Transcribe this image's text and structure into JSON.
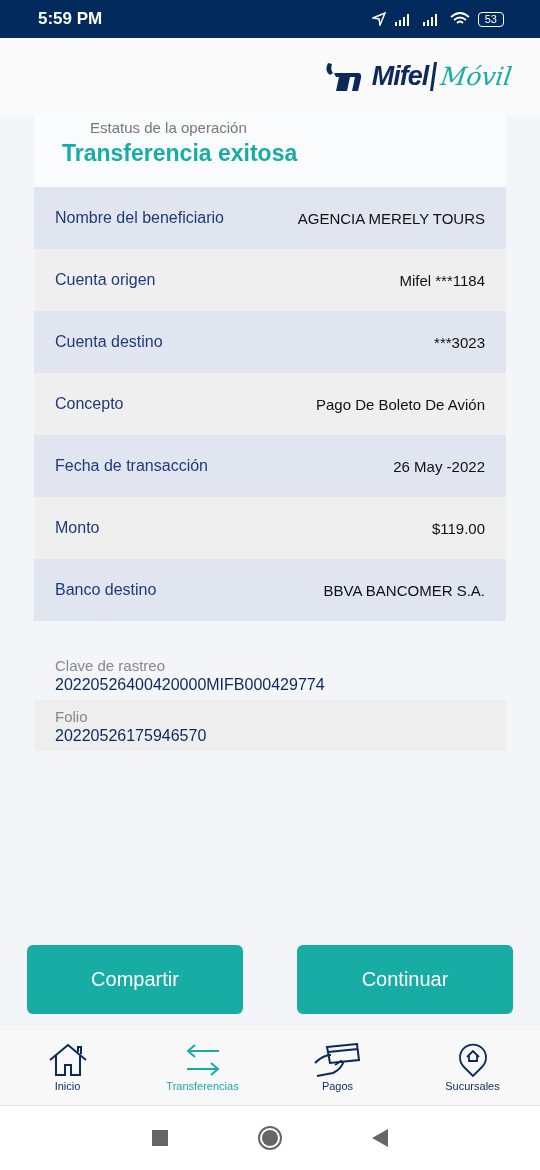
{
  "status_bar": {
    "time": "5:59 PM",
    "battery": "53"
  },
  "header": {
    "logo_brand": "Mifel",
    "logo_product": "Móvil"
  },
  "status": {
    "label": "Estatus de la operación",
    "title": "Transferencia exitosa"
  },
  "details": [
    {
      "label": "Nombre del beneficiario",
      "value": "AGENCIA MERELY TOURS"
    },
    {
      "label": "Cuenta origen",
      "value": "Mifel ***1184"
    },
    {
      "label": "Cuenta destino",
      "value": "***3023"
    },
    {
      "label": "Concepto",
      "value": "Pago De Boleto De Avión"
    },
    {
      "label": "Fecha de transacción",
      "value": "26 May -2022"
    },
    {
      "label": "Monto",
      "value": "$119.00"
    },
    {
      "label": "Banco destino",
      "value": "BBVA BANCOMER S.A."
    }
  ],
  "references": [
    {
      "label": "Clave de rastreo",
      "value": "20220526400420000MIFB000429774"
    },
    {
      "label": "Folio",
      "value": "20220526175946570"
    }
  ],
  "buttons": [
    "Compartir",
    "Continuar"
  ],
  "nav": [
    {
      "kind": "home",
      "label": "Inicio",
      "selected": false
    },
    {
      "kind": "transfer",
      "label": "Transferencias",
      "selected": true
    },
    {
      "kind": "payment",
      "label": "Pagos",
      "selected": false
    },
    {
      "kind": "branch",
      "label": "Sucursales",
      "selected": false
    }
  ]
}
